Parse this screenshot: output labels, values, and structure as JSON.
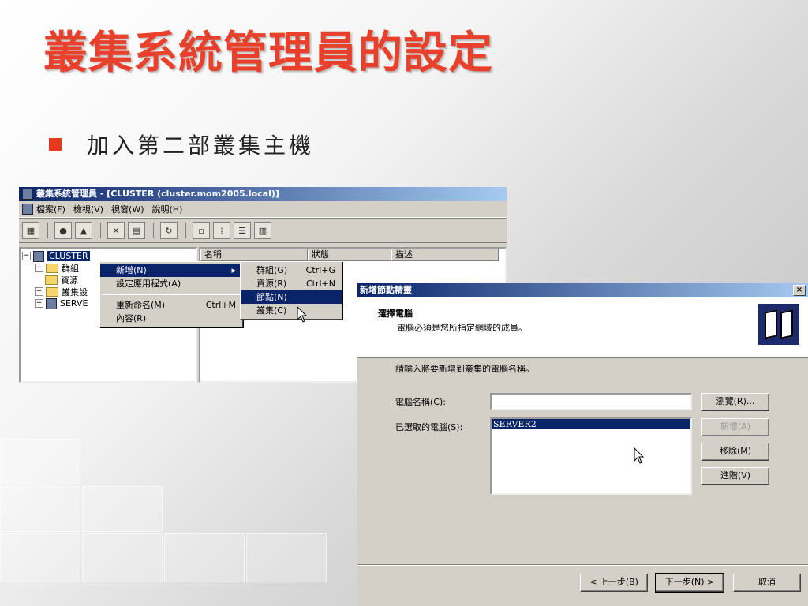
{
  "slide": {
    "title": "叢集系統管理員的設定",
    "bullet": "加入第二部叢集主機"
  },
  "mmc": {
    "title": "叢集系統管理員 - [CLUSTER (cluster.mom2005.local)]",
    "menu": [
      "檔案(F)",
      "檢視(V)",
      "視窗(W)",
      "說明(H)"
    ],
    "tree": {
      "root": "CLUSTER",
      "items": [
        "群組",
        "資源",
        "叢集設",
        "SERVE"
      ]
    },
    "columns": [
      "名稱",
      "狀態",
      "描述"
    ]
  },
  "context_menu": {
    "items": [
      {
        "label": "新增(N)",
        "arrow": "▸",
        "highlighted": true
      },
      {
        "label": "設定應用程式(A)"
      },
      {
        "label": "重新命名(M)",
        "shortcut": "Ctrl+M"
      },
      {
        "label": "內容(R)"
      }
    ]
  },
  "submenu": {
    "items": [
      {
        "label": "群組(G)",
        "shortcut": "Ctrl+G"
      },
      {
        "label": "資源(R)",
        "shortcut": "Ctrl+N"
      },
      {
        "label": "節點(N)",
        "highlighted": true
      },
      {
        "label": "叢集(C)"
      }
    ]
  },
  "wizard": {
    "title": "新增節點精靈",
    "close": "×",
    "header_title": "選擇電腦",
    "header_subtitle": "電腦必須是您所指定網域的成員。",
    "prompt": "請輸入將要新增到叢集的電腦名稱。",
    "computer_name_label": "電腦名稱(C):",
    "computer_name_value": "",
    "selected_label": "已選取的電腦(S):",
    "selected_items": [
      "SERVER2"
    ],
    "buttons": {
      "browse": "瀏覽(R)...",
      "add": "新增(A)",
      "remove": "移除(M)",
      "advanced": "進階(V)",
      "back": "< 上一步(B)",
      "next": "下一步(N) >",
      "cancel": "取消"
    }
  },
  "colors": {
    "title_red": "#e8402a",
    "bullet_red": "#e53a1f",
    "selection_blue": "#0a246a"
  }
}
